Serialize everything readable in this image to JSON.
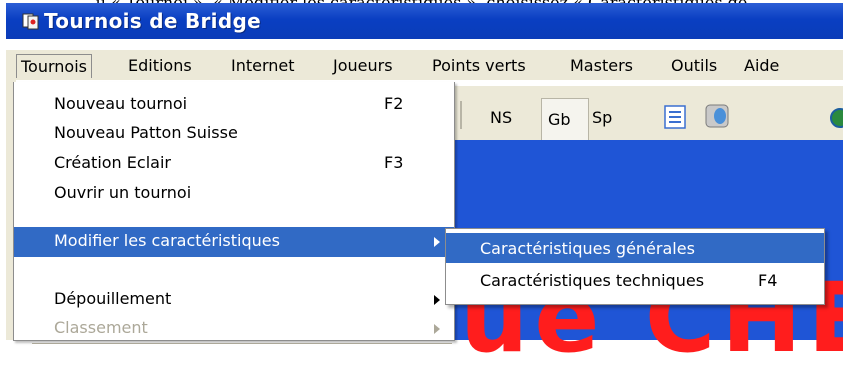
{
  "caption": "u « Tournoi », « Modifier les caractéristiques », choisissez « Caractéristiques gé",
  "window": {
    "title": "Tournois de Bridge",
    "icon": "app-cards-icon"
  },
  "menubar": {
    "items": [
      "Tournois",
      "Editions",
      "Internet",
      "Joueurs",
      "Points verts",
      "Masters",
      "Outils",
      "Aide"
    ]
  },
  "toolbar": {
    "buttons": [
      "NS",
      "Gb",
      "Sp"
    ],
    "icons": [
      "list-icon",
      "database-icon",
      "globe-icon"
    ]
  },
  "canvas": {
    "text": "ue CHE"
  },
  "tournois_menu": {
    "items": [
      {
        "label": "Nouveau tournoi",
        "shortcut": "F2"
      },
      {
        "label": "Nouveau Patton Suisse",
        "shortcut": ""
      },
      {
        "label": "Création Eclair",
        "shortcut": "F3"
      },
      {
        "label": "Ouvrir un tournoi",
        "shortcut": ""
      },
      {
        "label": "Modifier les caractéristiques",
        "shortcut": ""
      },
      {
        "label": "Dépouillement",
        "shortcut": ""
      },
      {
        "label": "Classement",
        "shortcut": ""
      }
    ]
  },
  "submenu": {
    "items": [
      {
        "label": "Caractéristiques générales",
        "shortcut": ""
      },
      {
        "label": "Caractéristiques techniques",
        "shortcut": "F4"
      }
    ]
  },
  "colors": {
    "titlebar": "#0a3fc2",
    "highlight": "#316ac5",
    "menu_bg": "#ece9d8",
    "canvas": "#1f55d6",
    "canvas_text": "#ff1d1d"
  }
}
